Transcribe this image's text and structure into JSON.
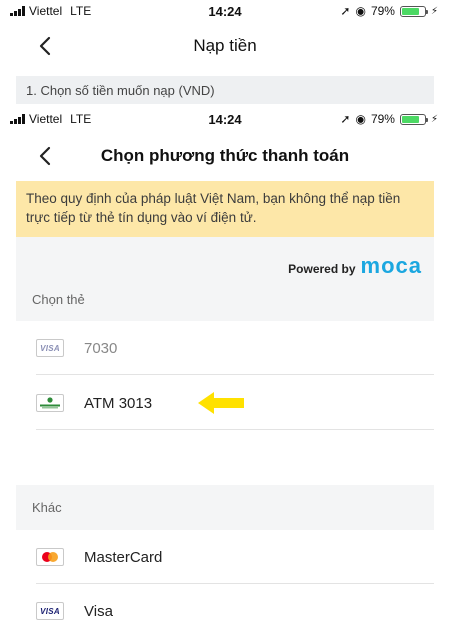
{
  "status1": {
    "carrier": "Viettel",
    "network": "LTE",
    "time": "14:24",
    "battery": "79%"
  },
  "nav1": {
    "title": "Nạp tiền"
  },
  "section1": {
    "label": "1. Chọn số tiền muốn nạp (VND)"
  },
  "status2": {
    "carrier": "Viettel",
    "network": "LTE",
    "time": "14:24",
    "battery": "79%"
  },
  "nav2": {
    "title": "Chọn phương thức thanh toán"
  },
  "notice": {
    "text": "Theo quy định của pháp luật Việt Nam, bạn không thể nạp tiền trực tiếp từ thẻ tín dụng vào ví điện tử."
  },
  "powered": {
    "prefix": "Powered by",
    "brand": "moca"
  },
  "cards": {
    "label": "Chọn thẻ",
    "items": [
      {
        "icon": "visa-icon",
        "icon_text": "VISA",
        "label": "7030",
        "disabled": true
      },
      {
        "icon": "vietcombank-icon",
        "icon_text": "Vietcombank",
        "label": "ATM 3013",
        "disabled": false
      }
    ]
  },
  "other": {
    "label": "Khác",
    "items": [
      {
        "icon": "mastercard-icon",
        "label": "MasterCard"
      },
      {
        "icon": "visa-icon",
        "icon_text": "VISA",
        "label": "Visa"
      }
    ]
  },
  "colors": {
    "notice_bg": "#fde7a8",
    "moca_blue": "#1ba7e0",
    "arrow_yellow": "#ffe100",
    "section_bg": "#eef0f2"
  }
}
